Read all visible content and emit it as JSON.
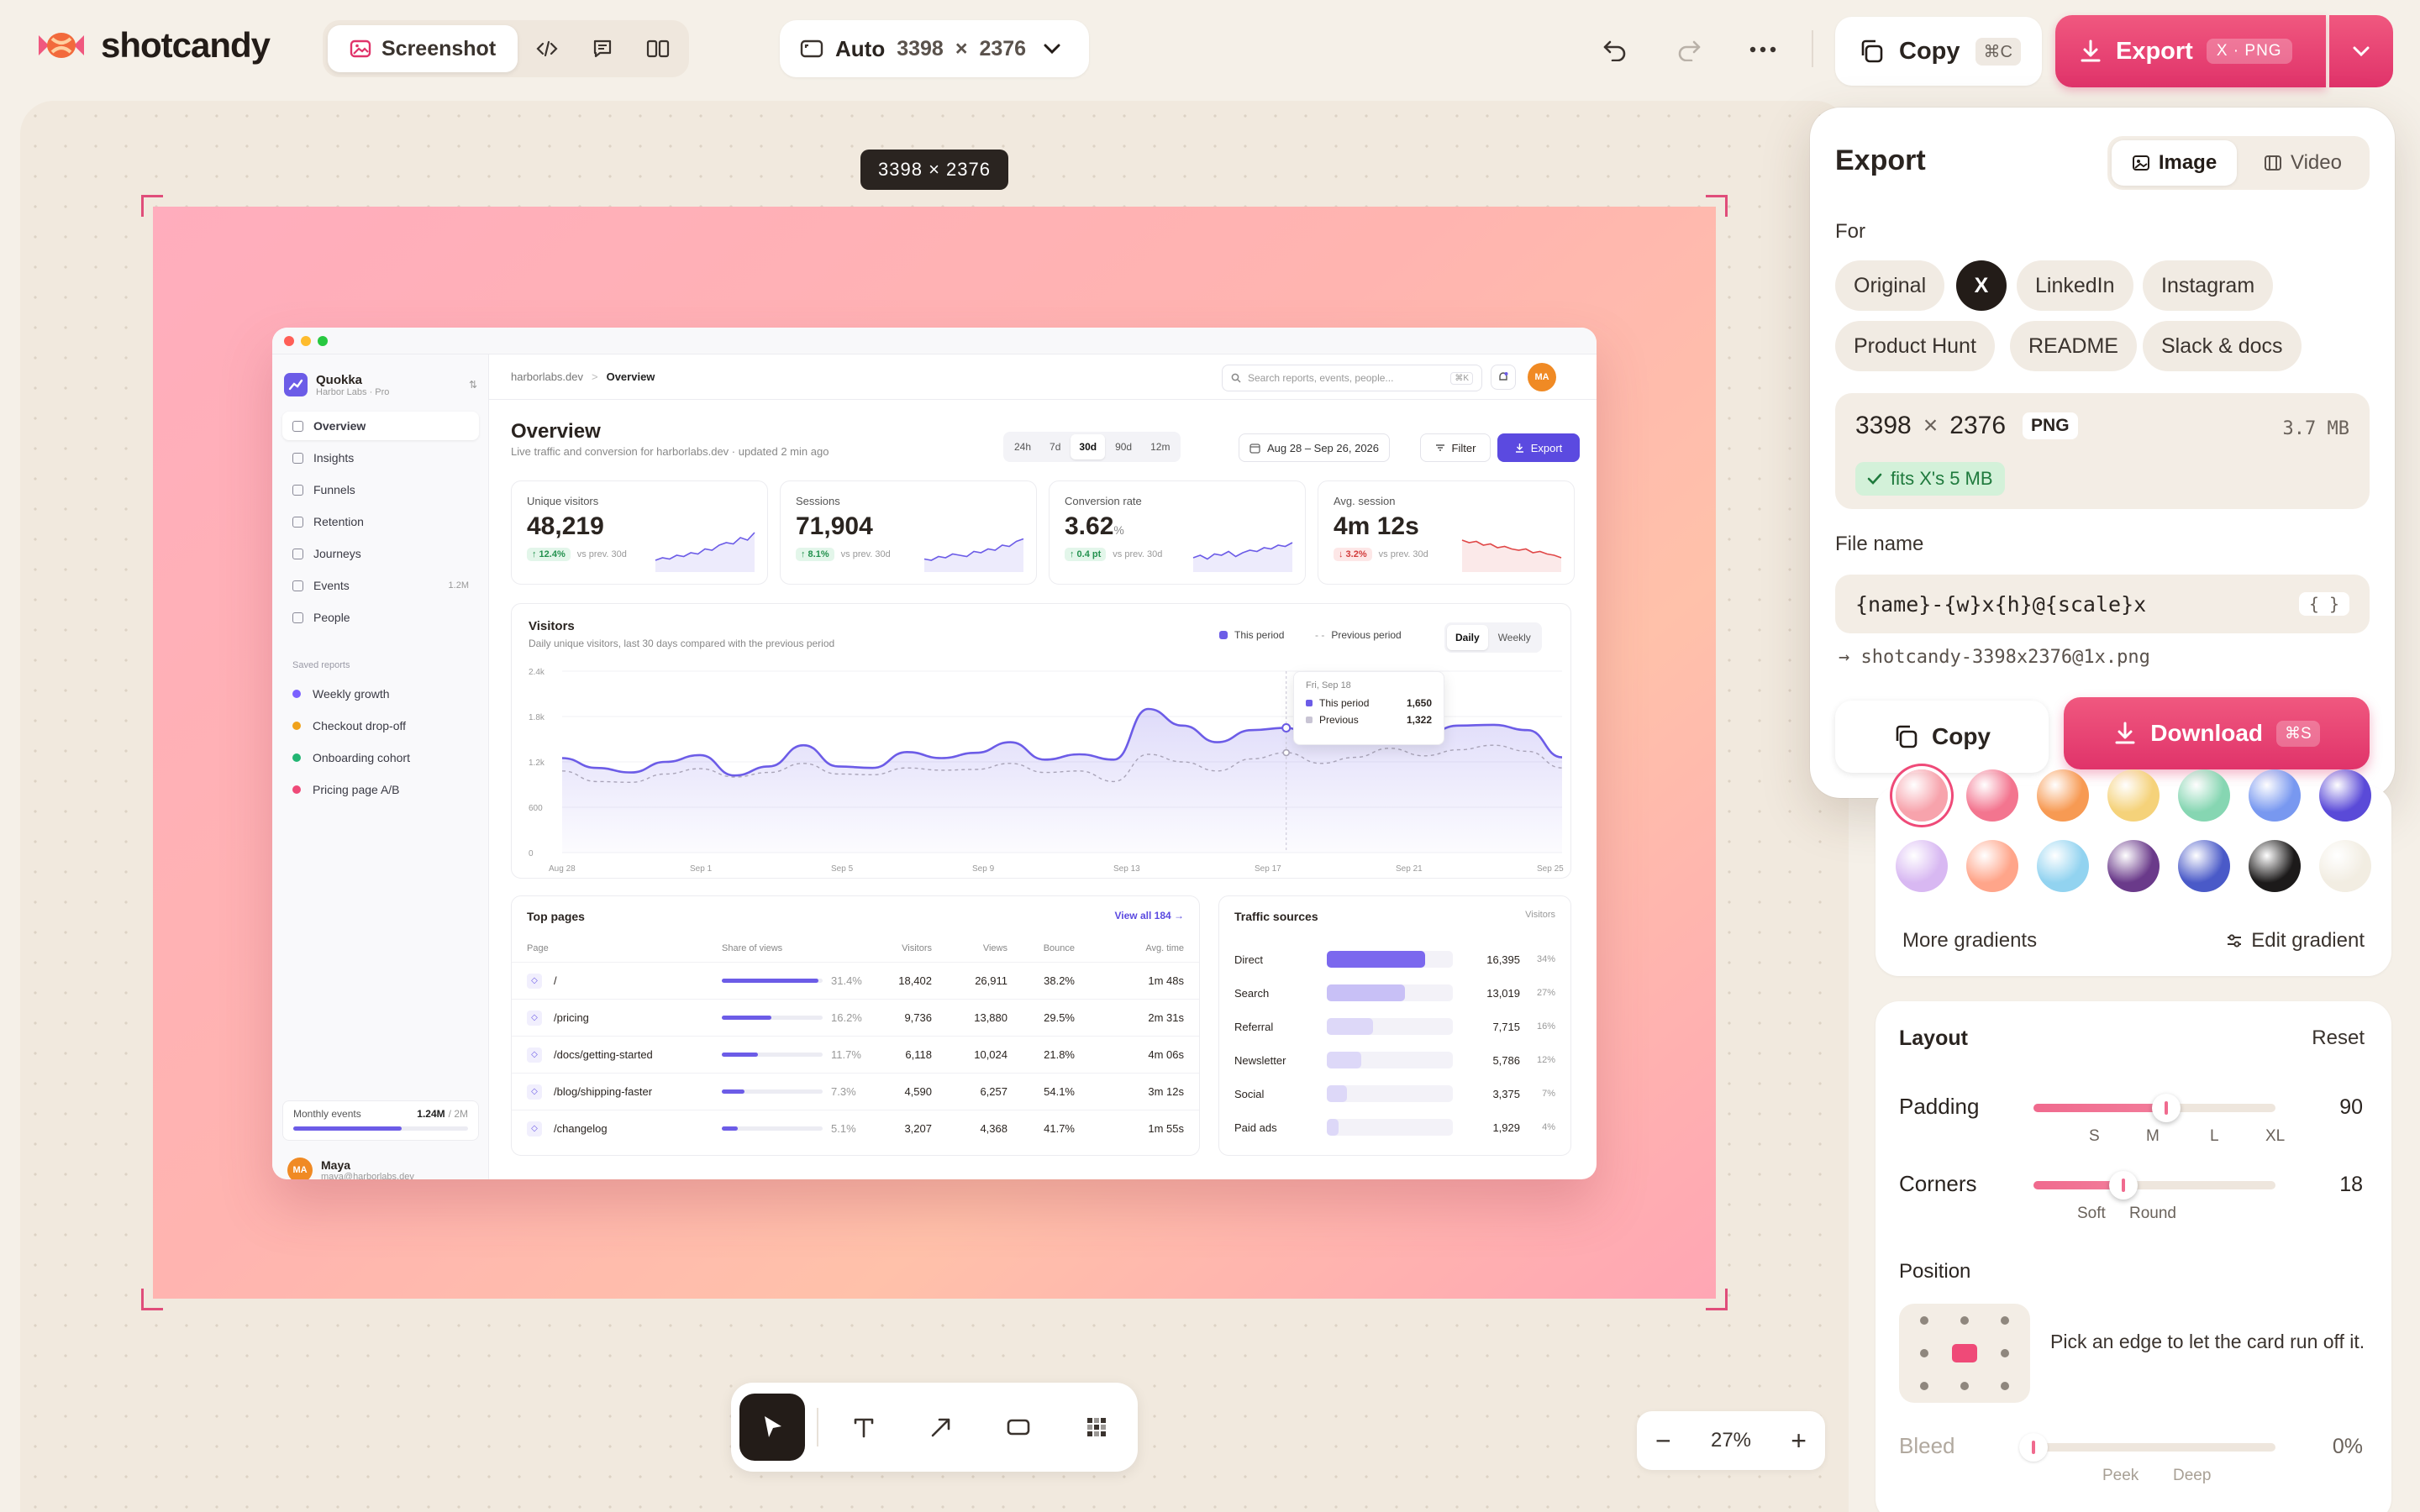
{
  "app": {
    "name": "shotcandy"
  },
  "mode_tabs": [
    {
      "label": "Screenshot",
      "icon": "image-icon"
    },
    {
      "icon": "code-icon"
    },
    {
      "icon": "comment-icon"
    },
    {
      "icon": "compare-icon"
    }
  ],
  "size_selector": {
    "mode": "Auto",
    "width": "3398",
    "times": "×",
    "height": "2376"
  },
  "toolbar": {
    "copy_label": "Copy",
    "copy_shortcut": "⌘C",
    "export_label": "Export",
    "export_tag": "X · PNG"
  },
  "canvas": {
    "dim_badge": "3398 × 2376"
  },
  "card": {
    "workspace": {
      "name": "Quokka",
      "sub": "Harbor Labs · Pro"
    },
    "nav": [
      {
        "label": "Overview",
        "active": true
      },
      {
        "label": "Insights"
      },
      {
        "label": "Funnels"
      },
      {
        "label": "Retention"
      },
      {
        "label": "Journeys"
      },
      {
        "label": "Events",
        "count": "1.2M"
      },
      {
        "label": "People"
      }
    ],
    "saved_title": "Saved reports",
    "saved": [
      {
        "label": "Weekly growth",
        "color": "#7b61ff"
      },
      {
        "label": "Checkout drop-off",
        "color": "#f0a21b"
      },
      {
        "label": "Onboarding cohort",
        "color": "#22b573"
      },
      {
        "label": "Pricing page A/B",
        "color": "#ef4a78"
      }
    ],
    "quota": {
      "label": "Monthly events",
      "value": "1.24M",
      "max": "/ 2M",
      "progress": 0.62
    },
    "user": {
      "initials": "MA",
      "name": "Maya",
      "email": "maya@harborlabs.dev"
    },
    "breadcrumb": {
      "domain": "harborlabs.dev",
      "sep": ">",
      "page": "Overview"
    },
    "search_placeholder": "Search reports, events, people...",
    "search_kbd": "⌘K",
    "title": "Overview",
    "subtitle": "Live traffic and conversion for harborlabs.dev · updated 2 min ago",
    "ranges": [
      "24h",
      "7d",
      "30d",
      "90d",
      "12m"
    ],
    "date_range": "Aug 28 – Sep 26, 2026",
    "filter_label": "Filter",
    "export_label": "Export",
    "kpis": [
      {
        "label": "Unique visitors",
        "value": "48,219",
        "unit": "",
        "delta": "↑ 12.4%",
        "trend": "up",
        "note": "vs prev. 30d"
      },
      {
        "label": "Sessions",
        "value": "71,904",
        "unit": "",
        "delta": "↑ 8.1%",
        "trend": "up",
        "note": "vs prev. 30d"
      },
      {
        "label": "Conversion rate",
        "value": "3.62",
        "unit": "%",
        "delta": "↑ 0.4 pt",
        "trend": "up",
        "note": "vs prev. 30d"
      },
      {
        "label": "Avg. session",
        "value": "4m 12s",
        "unit": "",
        "delta": "↓ 3.2%",
        "trend": "down",
        "note": "vs prev. 30d"
      }
    ],
    "visitors": {
      "title": "Visitors",
      "subtitle": "Daily unique visitors, last 30 days compared with the previous period",
      "legend_this": "This period",
      "legend_prev": "Previous period",
      "toggle": [
        "Daily",
        "Weekly"
      ],
      "tooltip": {
        "date": "Fri, Sep 18",
        "this_label": "This period",
        "this_value": "1,650",
        "prev_label": "Previous",
        "prev_value": "1,322"
      }
    },
    "top_pages": {
      "title": "Top pages",
      "view_all": "View all 184 →",
      "columns": [
        "Page",
        "Share of views",
        "Visitors",
        "Views",
        "Bounce",
        "Avg. time"
      ],
      "rows": [
        {
          "page": "/",
          "share": "31.4%",
          "visitors": "18,402",
          "views": "26,911",
          "bounce": "38.2%",
          "time": "1m 48s",
          "frac": 0.314
        },
        {
          "page": "/pricing",
          "share": "16.2%",
          "visitors": "9,736",
          "views": "13,880",
          "bounce": "29.5%",
          "time": "2m 31s",
          "frac": 0.162
        },
        {
          "page": "/docs/getting-started",
          "share": "11.7%",
          "visitors": "6,118",
          "views": "10,024",
          "bounce": "21.8%",
          "time": "4m 06s",
          "frac": 0.117
        },
        {
          "page": "/blog/shipping-faster",
          "share": "7.3%",
          "visitors": "4,590",
          "views": "6,257",
          "bounce": "54.1%",
          "time": "3m 12s",
          "frac": 0.073
        },
        {
          "page": "/changelog",
          "share": "5.1%",
          "visitors": "3,207",
          "views": "4,368",
          "bounce": "41.7%",
          "time": "1m 55s",
          "frac": 0.051
        }
      ]
    },
    "traffic": {
      "title": "Traffic sources",
      "column": "Visitors",
      "rows": [
        {
          "name": "Direct",
          "value": "16,395",
          "pct": "34%",
          "frac": 0.34
        },
        {
          "name": "Search",
          "value": "13,019",
          "pct": "27%",
          "frac": 0.27
        },
        {
          "name": "Referral",
          "value": "7,715",
          "pct": "16%",
          "frac": 0.16
        },
        {
          "name": "Newsletter",
          "value": "5,786",
          "pct": "12%",
          "frac": 0.12
        },
        {
          "name": "Social",
          "value": "3,375",
          "pct": "7%",
          "frac": 0.07
        },
        {
          "name": "Paid ads",
          "value": "1,929",
          "pct": "4%",
          "frac": 0.04
        }
      ]
    }
  },
  "chart_data": {
    "type": "area",
    "title": "Visitors",
    "x_ticks": [
      "Aug 28",
      "Sep 1",
      "Sep 5",
      "Sep 9",
      "Sep 13",
      "Sep 17",
      "Sep 21",
      "Sep 25"
    ],
    "y_ticks": [
      "2.4k",
      "1.8k",
      "1.2k",
      "600",
      "0"
    ],
    "ylim": [
      0,
      2400
    ],
    "series": [
      {
        "name": "This period",
        "color": "#6c5ce7",
        "values": [
          1250,
          1120,
          1060,
          1200,
          1290,
          1020,
          1140,
          1420,
          1140,
          1120,
          1330,
          1250,
          1320,
          1460,
          1230,
          1300,
          1230,
          1900,
          1680,
          1460,
          1620,
          1650,
          1460,
          1520,
          1700,
          1560,
          1680,
          1690,
          1620,
          1260
        ]
      },
      {
        "name": "Previous period",
        "color": "#a9a4b8",
        "values": [
          1080,
          940,
          930,
          1040,
          1110,
          1000,
          1060,
          1180,
          1040,
          1030,
          1120,
          1090,
          1100,
          1180,
          1060,
          1080,
          940,
          1300,
          1200,
          1080,
          1240,
          1322,
          1180,
          1260,
          1380,
          1280,
          1360,
          1420,
          1340,
          1120
        ]
      }
    ]
  },
  "export_panel": {
    "title": "Export",
    "tabs": [
      {
        "label": "Image",
        "active": true
      },
      {
        "label": "Video"
      }
    ],
    "for_label": "For",
    "presets": [
      "Original",
      "X",
      "LinkedIn",
      "Instagram",
      "Product Hunt",
      "README",
      "Slack & docs"
    ],
    "size": {
      "w": "3398",
      "times": "×",
      "h": "2376",
      "format": "PNG",
      "filesize": "3.7 MB",
      "fits": "fits X's 5 MB"
    },
    "filename_label": "File name",
    "filename_template": "{name}-{w}x{h}@{scale}x",
    "filename_token": "{ }",
    "filename_preview": "→ shotcandy-3398x2376@1x.png",
    "copy_label": "Copy",
    "download_label": "Download",
    "download_kbd": "⌘S"
  },
  "background": {
    "more_label": "More gradients",
    "edit_label": "Edit gradient",
    "swatches": [
      "#f7a3ac",
      "#f3758f",
      "#f79a53",
      "#f5d27a",
      "#86d6b2",
      "#7898f0",
      "#5a4ad8",
      "#d8b8f2",
      "#ffa58a",
      "#92d3f0",
      "#6a3a8a",
      "#4a5ac8",
      "#1c1a1a",
      "#f2ede2"
    ]
  },
  "layout": {
    "title": "Layout",
    "reset": "Reset",
    "padding": {
      "label": "Padding",
      "value": "90",
      "ticks": [
        "S",
        "M",
        "L",
        "XL"
      ],
      "level": 0.55
    },
    "corners": {
      "label": "Corners",
      "value": "18",
      "ticks": [
        "Soft",
        "Round"
      ],
      "level": 0.37
    },
    "position_label": "Position",
    "position_hint": "Pick an edge to let the card run off it.",
    "bleed": {
      "label": "Bleed",
      "value": "0%",
      "ticks": [
        "Peek",
        "Deep"
      ],
      "level": 0
    }
  },
  "zoom": {
    "value": "27%",
    "minus": "−",
    "plus": "+"
  }
}
